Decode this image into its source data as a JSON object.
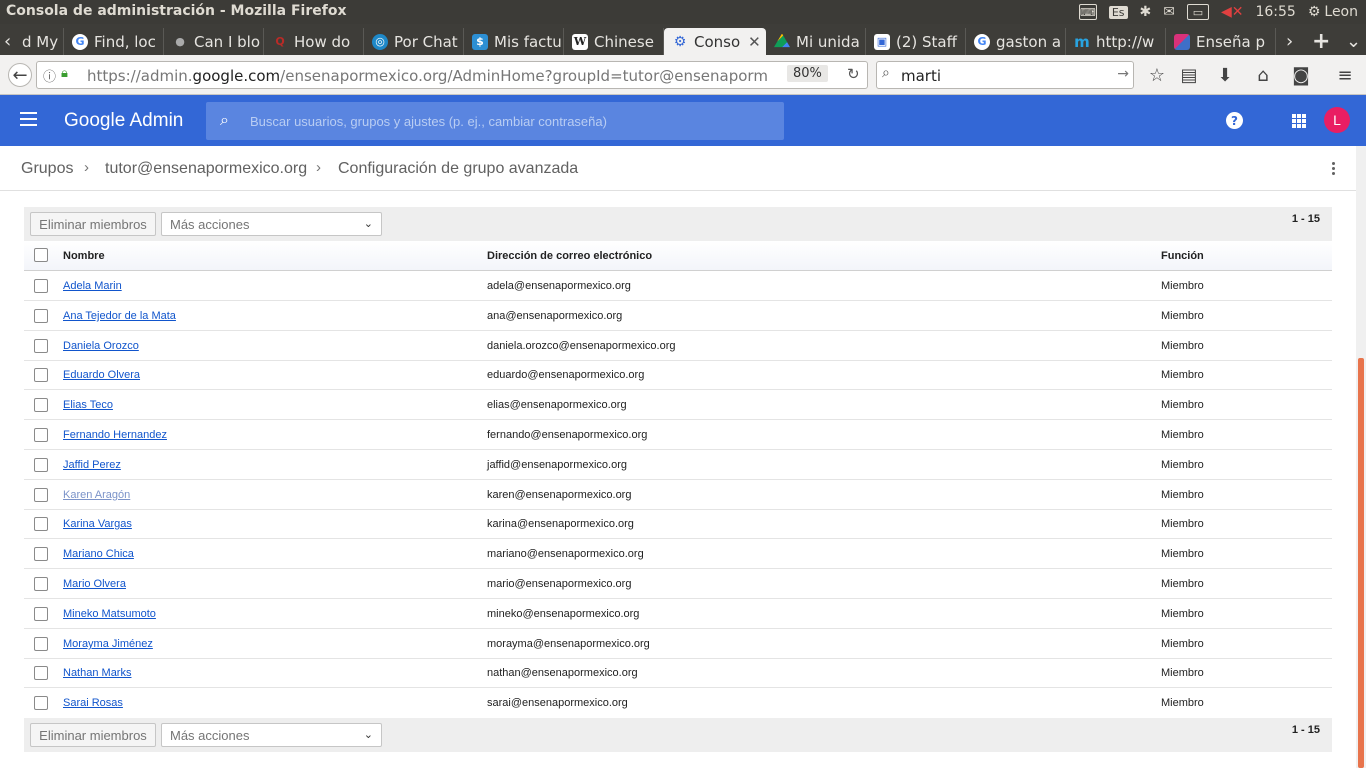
{
  "window": {
    "title": "Consola de administración - Mozilla Firefox",
    "tray": {
      "lang": "Es",
      "time": "16:55",
      "user": "Leon"
    }
  },
  "tabs": [
    {
      "label": "d My",
      "icon": "generic-tab-icon"
    },
    {
      "label": "Find, loc",
      "icon": "google-icon"
    },
    {
      "label": "Can I blo",
      "icon": "apple-icon"
    },
    {
      "label": "How do",
      "icon": "quora-icon"
    },
    {
      "label": "Por Chat",
      "icon": "globe-icon"
    },
    {
      "label": "Mis factu",
      "icon": "invoice-icon"
    },
    {
      "label": "Chinese",
      "icon": "wikipedia-icon"
    },
    {
      "label": "Conso",
      "icon": "admin-icon",
      "active": true
    },
    {
      "label": "Mi unida",
      "icon": "drive-icon"
    },
    {
      "label": "(2) Staff",
      "icon": "staff-icon"
    },
    {
      "label": "gaston a",
      "icon": "google-icon"
    },
    {
      "label": "http://w",
      "icon": "m-icon"
    },
    {
      "label": "Enseña p",
      "icon": "ensena-icon"
    }
  ],
  "nav": {
    "url_prefix": "https://admin.",
    "url_domain": "google.com",
    "url_rest": "/ensenapormexico.org/AdminHome?groupId=tutor@ensenapormexico.c",
    "zoom": "80%",
    "search_value": "marti"
  },
  "header": {
    "logo": "Google Admin",
    "search_placeholder": "Buscar usuarios, grupos y ajustes (p. ej., cambiar contraseña)",
    "avatar_letter": "L"
  },
  "breadcrumb": {
    "items": [
      "Grupos",
      "tutor@ensenapormexico.org",
      "Configuración de grupo avanzada"
    ]
  },
  "table": {
    "remove_button": "Eliminar miembros",
    "more_actions": "Más acciones",
    "range": "1 - 15",
    "columns": {
      "name": "Nombre",
      "email": "Dirección de correo electrónico",
      "role": "Función"
    },
    "rows": [
      {
        "name": "Adela Marin",
        "email": "adela@ensenapormexico.org",
        "role": "Miembro"
      },
      {
        "name": "Ana Tejedor de la Mata",
        "email": "ana@ensenapormexico.org",
        "role": "Miembro"
      },
      {
        "name": "Daniela Orozco",
        "email": "daniela.orozco@ensenapormexico.org",
        "role": "Miembro"
      },
      {
        "name": "Eduardo Olvera",
        "email": "eduardo@ensenapormexico.org",
        "role": "Miembro"
      },
      {
        "name": "Elias Teco",
        "email": "elias@ensenapormexico.org",
        "role": "Miembro"
      },
      {
        "name": "Fernando Hernandez",
        "email": "fernando@ensenapormexico.org",
        "role": "Miembro"
      },
      {
        "name": "Jaffid Perez",
        "email": "jaffid@ensenapormexico.org",
        "role": "Miembro"
      },
      {
        "name": "Karen Aragón",
        "email": "karen@ensenapormexico.org",
        "role": "Miembro",
        "visited": true
      },
      {
        "name": "Karina Vargas",
        "email": "karina@ensenapormexico.org",
        "role": "Miembro"
      },
      {
        "name": "Mariano Chica",
        "email": "mariano@ensenapormexico.org",
        "role": "Miembro"
      },
      {
        "name": "Mario Olvera",
        "email": "mario@ensenapormexico.org",
        "role": "Miembro"
      },
      {
        "name": "Mineko Matsumoto",
        "email": "mineko@ensenapormexico.org",
        "role": "Miembro"
      },
      {
        "name": "Morayma Jiménez",
        "email": "morayma@ensenapormexico.org",
        "role": "Miembro"
      },
      {
        "name": "Nathan Marks",
        "email": "nathan@ensenapormexico.org",
        "role": "Miembro"
      },
      {
        "name": "Sarai Rosas",
        "email": "sarai@ensenapormexico.org",
        "role": "Miembro"
      }
    ]
  },
  "colors": {
    "admin_blue": "#3367d6",
    "link": "#1155cc",
    "avatar": "#e91e63",
    "scroll_thumb": "#e8744c"
  }
}
